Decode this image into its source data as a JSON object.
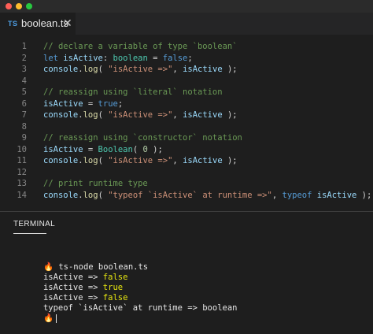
{
  "window": {
    "controls": [
      "close",
      "minimize",
      "maximize"
    ]
  },
  "tab": {
    "lang_badge": "TS",
    "filename": "boolean.ts",
    "close_glyph": "✕"
  },
  "editor": {
    "lines": [
      {
        "n": "1",
        "tokens": [
          {
            "t": "// declare a variable of type `boolean`",
            "c": "comment"
          }
        ]
      },
      {
        "n": "2",
        "tokens": [
          {
            "t": "let ",
            "c": "kw"
          },
          {
            "t": "isActive",
            "c": "var"
          },
          {
            "t": ": ",
            "c": "plain"
          },
          {
            "t": "boolean",
            "c": "type"
          },
          {
            "t": " = ",
            "c": "plain"
          },
          {
            "t": "false",
            "c": "kw"
          },
          {
            "t": ";",
            "c": "plain"
          }
        ]
      },
      {
        "n": "3",
        "tokens": [
          {
            "t": "console",
            "c": "var"
          },
          {
            "t": ".",
            "c": "plain"
          },
          {
            "t": "log",
            "c": "fn"
          },
          {
            "t": "( ",
            "c": "plain"
          },
          {
            "t": "\"isActive =>\"",
            "c": "str"
          },
          {
            "t": ", ",
            "c": "plain"
          },
          {
            "t": "isActive",
            "c": "var"
          },
          {
            "t": " );",
            "c": "plain"
          }
        ]
      },
      {
        "n": "4",
        "tokens": []
      },
      {
        "n": "5",
        "tokens": [
          {
            "t": "// reassign using `literal` notation",
            "c": "comment"
          }
        ]
      },
      {
        "n": "6",
        "tokens": [
          {
            "t": "isActive",
            "c": "var"
          },
          {
            "t": " = ",
            "c": "plain"
          },
          {
            "t": "true",
            "c": "kw"
          },
          {
            "t": ";",
            "c": "plain"
          }
        ]
      },
      {
        "n": "7",
        "tokens": [
          {
            "t": "console",
            "c": "var"
          },
          {
            "t": ".",
            "c": "plain"
          },
          {
            "t": "log",
            "c": "fn"
          },
          {
            "t": "( ",
            "c": "plain"
          },
          {
            "t": "\"isActive =>\"",
            "c": "str"
          },
          {
            "t": ", ",
            "c": "plain"
          },
          {
            "t": "isActive",
            "c": "var"
          },
          {
            "t": " );",
            "c": "plain"
          }
        ]
      },
      {
        "n": "8",
        "tokens": []
      },
      {
        "n": "9",
        "tokens": [
          {
            "t": "// reassign using `constructor` notation",
            "c": "comment"
          }
        ]
      },
      {
        "n": "10",
        "tokens": [
          {
            "t": "isActive",
            "c": "var"
          },
          {
            "t": " = ",
            "c": "plain"
          },
          {
            "t": "Boolean",
            "c": "type"
          },
          {
            "t": "( ",
            "c": "plain"
          },
          {
            "t": "0",
            "c": "num"
          },
          {
            "t": " );",
            "c": "plain"
          }
        ]
      },
      {
        "n": "11",
        "tokens": [
          {
            "t": "console",
            "c": "var"
          },
          {
            "t": ".",
            "c": "plain"
          },
          {
            "t": "log",
            "c": "fn"
          },
          {
            "t": "( ",
            "c": "plain"
          },
          {
            "t": "\"isActive =>\"",
            "c": "str"
          },
          {
            "t": ", ",
            "c": "plain"
          },
          {
            "t": "isActive",
            "c": "var"
          },
          {
            "t": " );",
            "c": "plain"
          }
        ]
      },
      {
        "n": "12",
        "tokens": []
      },
      {
        "n": "13",
        "tokens": [
          {
            "t": "// print runtime type",
            "c": "comment"
          }
        ]
      },
      {
        "n": "14",
        "tokens": [
          {
            "t": "console",
            "c": "var"
          },
          {
            "t": ".",
            "c": "plain"
          },
          {
            "t": "log",
            "c": "fn"
          },
          {
            "t": "( ",
            "c": "plain"
          },
          {
            "t": "\"typeof `isActive` at runtime =>\"",
            "c": "str"
          },
          {
            "t": ", ",
            "c": "plain"
          },
          {
            "t": "typeof",
            "c": "kw"
          },
          {
            "t": " ",
            "c": "plain"
          },
          {
            "t": "isActive",
            "c": "var"
          },
          {
            "t": " );",
            "c": "plain"
          }
        ]
      }
    ]
  },
  "panel": {
    "tab_label": "TERMINAL"
  },
  "terminal": {
    "prompt_icon": "🔥",
    "command": "ts-node boolean.ts",
    "outputs": [
      {
        "prefix": "isActive => ",
        "value": "false",
        "highlight": true
      },
      {
        "prefix": "isActive => ",
        "value": "true",
        "highlight": true
      },
      {
        "prefix": "isActive => ",
        "value": "false",
        "highlight": true
      },
      {
        "prefix": "typeof `isActive` at runtime => boolean",
        "value": "",
        "highlight": false
      }
    ]
  },
  "colors": {
    "background": "#1e1e1e",
    "comment": "#6a9955",
    "keyword": "#569cd6",
    "variable": "#9cdcfe",
    "type": "#4ec9b0",
    "string": "#ce9178",
    "terminal_highlight": "#e5e510"
  }
}
